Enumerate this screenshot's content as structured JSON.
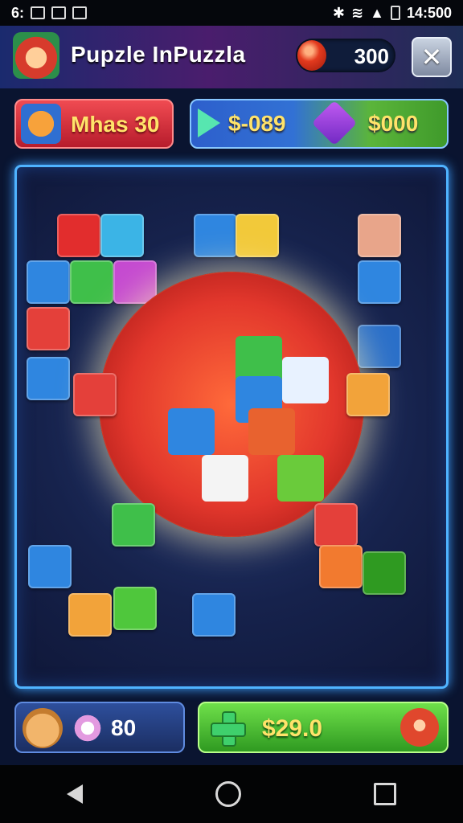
{
  "status_bar": {
    "left_text": "6:",
    "time": "14:500"
  },
  "header": {
    "title": "Pupzle InPuzzla",
    "coins": "300"
  },
  "moves": {
    "label": "Mhas 30"
  },
  "score": {
    "value_a": "$-089",
    "value_b": "$000"
  },
  "bottom": {
    "pieces_count": "80",
    "buy_label": "$29.0"
  },
  "colors": {
    "accent": "#4fb3ff",
    "red": "#e2372c",
    "green": "#3f9a2b",
    "gold": "#ffe36a"
  },
  "icons": [
    "logo-icon",
    "coin-icon",
    "close-icon",
    "moves-icon",
    "play-icon",
    "gem-icon",
    "bear-icon",
    "gear-icon",
    "cross-icon",
    "mascot-icon",
    "back-icon",
    "home-icon",
    "recent-icon"
  ]
}
